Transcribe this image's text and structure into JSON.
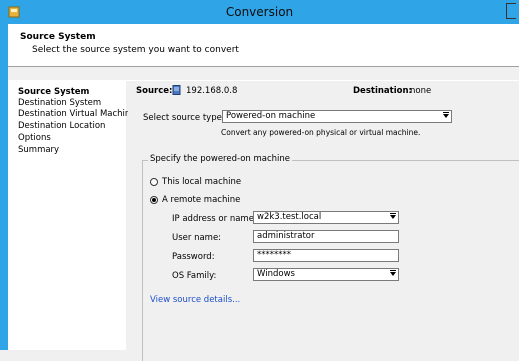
{
  "window": {
    "title": "Conversion"
  },
  "header": {
    "title": "Source System",
    "subtitle": "Select the source system you want to convert"
  },
  "nav": {
    "items": [
      {
        "label": "Source System",
        "active": true
      },
      {
        "label": "Destination System",
        "active": false
      },
      {
        "label": "Destination Virtual Machine",
        "active": false
      },
      {
        "label": "Destination Location",
        "active": false
      },
      {
        "label": "Options",
        "active": false
      },
      {
        "label": "Summary",
        "active": false
      }
    ]
  },
  "summary": {
    "source_label": "Source:",
    "source_value": "192.168.0.8",
    "destination_label": "Destination:",
    "destination_value": "none"
  },
  "source_type": {
    "label": "Select source type:",
    "value": "Powered-on machine",
    "hint": "Convert any powered-on physical or virtual machine."
  },
  "group": {
    "legend": "Specify the powered-on machine",
    "this_local_label": "This local machine",
    "remote_label": "A remote machine",
    "selected": "remote"
  },
  "form": {
    "ip_label": "IP address or name:",
    "ip_value": "w2k3.test.local",
    "user_label": "User name:",
    "user_value": "administrator",
    "password_label": "Password:",
    "password_value": "********",
    "os_label": "OS Family:",
    "os_value": "Windows"
  },
  "link": {
    "view_details": "View source details..."
  },
  "colors": {
    "titlebar": "#2fa4e7",
    "link": "#1d4fc7"
  }
}
